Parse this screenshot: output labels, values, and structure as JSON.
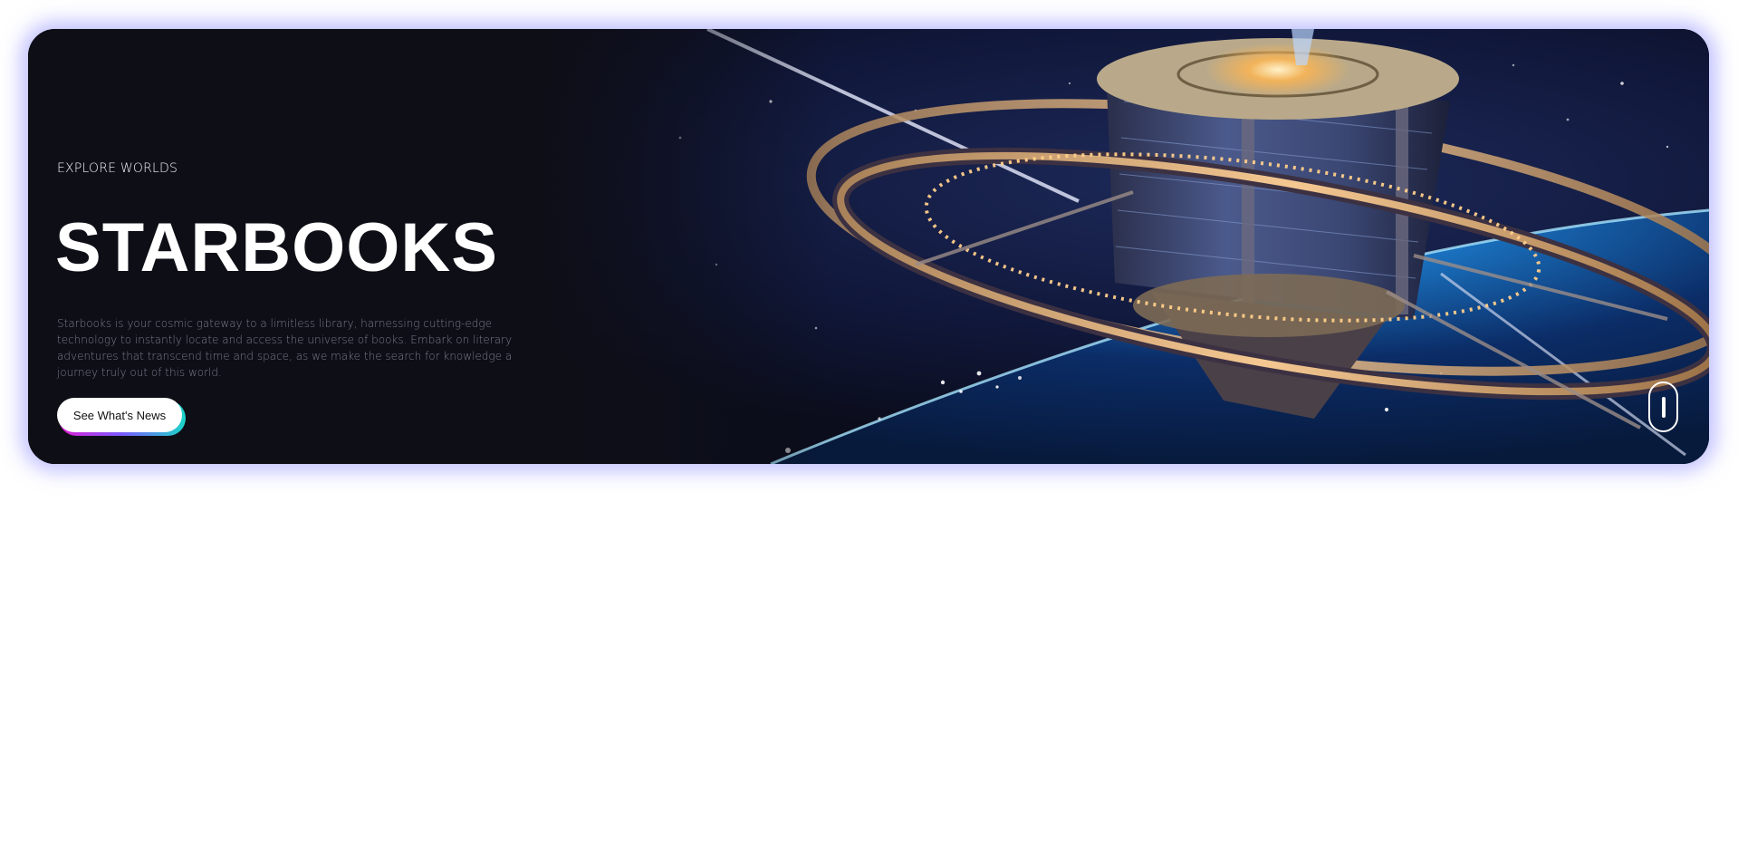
{
  "hero": {
    "eyebrow": "EXPLORE WORLDS",
    "title": "STARBOOKS",
    "description": "Starbooks is your cosmic gateway to a limitless library, harnessing cutting-edge technology to instantly locate and access the universe of books. Embark on literary adventures that transcend time and space, as we make the search for knowledge a journey truly out of this world.",
    "cta_label": "See What's News",
    "background_image": "space-station-illustration",
    "scroll_indicator_icon": "mouse-scroll-icon"
  },
  "colors": {
    "hero_background": "#0e0e16",
    "glow": "#8c8cff",
    "cta_gradient_start": "#e01fd2",
    "cta_gradient_end": "#19d6c8",
    "planet_glow": "#3fb2ff"
  }
}
